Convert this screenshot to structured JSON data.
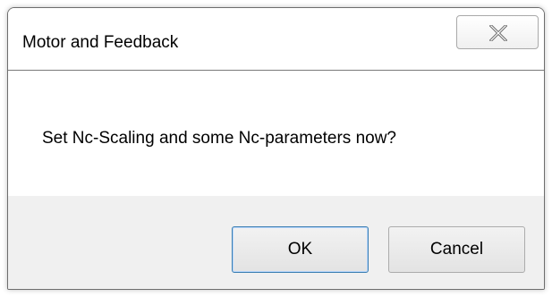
{
  "window": {
    "title": "Motor and Feedback",
    "close_icon": "close-icon"
  },
  "content": {
    "message": "Set Nc-Scaling and some Nc-parameters now?"
  },
  "buttons": {
    "ok_label": "OK",
    "cancel_label": "Cancel"
  },
  "colors": {
    "footer_background": "#f0f0f0",
    "default_button_border": "#3c7fb1"
  }
}
